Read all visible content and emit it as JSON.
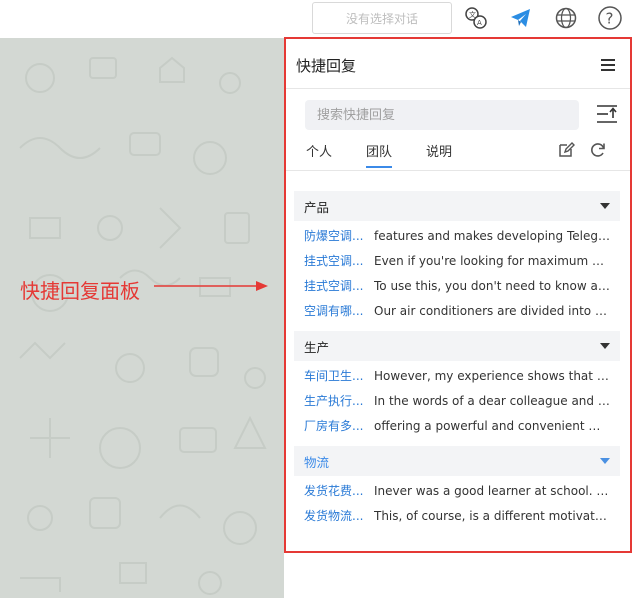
{
  "topbar": {
    "chat_select_placeholder": "没有选择对话",
    "icons": [
      "translate-icon",
      "telegram-icon",
      "globe-icon",
      "help-icon"
    ]
  },
  "annotation": {
    "label": "快捷回复面板",
    "color": "#e53935"
  },
  "panel": {
    "title": "快捷回复",
    "search_placeholder": "搜索快捷回复",
    "tabs": [
      {
        "label": "个人",
        "active": false
      },
      {
        "label": "团队",
        "active": true
      },
      {
        "label": "说明",
        "active": false
      }
    ],
    "groups": [
      {
        "name": "产品",
        "expanded_color": "dark",
        "items": [
          {
            "title": "防爆空调...",
            "text": "features and makes developing Telegram..."
          },
          {
            "title": "挂式空调...",
            "text": "Even if you're looking for maximum custo..."
          },
          {
            "title": "挂式空调...",
            "text": "To use this, you don't need to know anyth..."
          },
          {
            "title": "空调有哪...",
            "text": "Our air conditioners are divided into three..."
          }
        ]
      },
      {
        "name": "生产",
        "expanded_color": "dark",
        "items": [
          {
            "title": "车间卫生...",
            "text": "However, my experience shows that intell..."
          },
          {
            "title": "生产执行...",
            "text": "In the words of a dear colleague and mento..."
          },
          {
            "title": "厂房有多...",
            "text": "offering a powerful and convenient way to..."
          }
        ]
      },
      {
        "name": "物流",
        "expanded_color": "blue",
        "items": [
          {
            "title": "发货花费...",
            "text": "Inever was a good learner at school. Men..."
          },
          {
            "title": "发货物流...",
            "text": "This, of course, is a different motivation. ..."
          }
        ]
      }
    ],
    "accent_color": "#3b8ae8"
  }
}
